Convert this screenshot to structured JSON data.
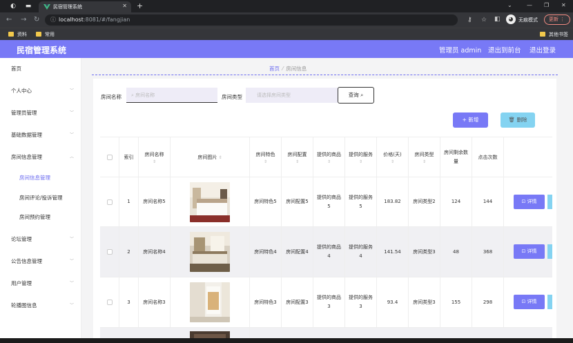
{
  "browser": {
    "tab_title": "民宿管理系统",
    "url_host": "localhost",
    "url_path": ":8081/#/fangjian",
    "incognito_label": "无痕模式",
    "update_label": "更新",
    "bookmarks": [
      "资料",
      "常用"
    ],
    "other_bookmarks": "其他书签"
  },
  "header": {
    "title": "民宿管理系统",
    "admin": "管理员 admin",
    "back_to_front": "退出到前台",
    "logout": "退出登录"
  },
  "sidebar": {
    "items": [
      {
        "label": "首页"
      },
      {
        "label": "个人中心"
      },
      {
        "label": "管理员管理"
      },
      {
        "label": "基础数据管理"
      },
      {
        "label": "房间信息管理"
      }
    ],
    "sub_items": [
      {
        "label": "房间信息管理"
      },
      {
        "label": "房间评论/投诉管理"
      },
      {
        "label": "房间预约管理"
      }
    ],
    "items_after": [
      {
        "label": "论坛管理"
      },
      {
        "label": "公告信息管理"
      },
      {
        "label": "用户管理"
      },
      {
        "label": "轮播图信息"
      }
    ]
  },
  "breadcrumb": {
    "home": "首页",
    "current": "房间信息"
  },
  "filters": {
    "name_label": "房间名称",
    "name_placeholder": "房间名称",
    "type_label": "房间类型",
    "type_placeholder": "请选择房间类型",
    "query_button": "查询"
  },
  "actions": {
    "add": "新增",
    "delete": "删除"
  },
  "table": {
    "headers": {
      "index": "索引",
      "name": "房间名称",
      "image": "房间图片",
      "feature": "房间特色",
      "config": "房间配置",
      "goods": "提供的商品",
      "service": "提供的服务",
      "price": "价格(天)",
      "type": "房间类型",
      "remaining": "房间剩余数量",
      "clicks": "点击次数"
    },
    "detail_label": "详情",
    "rows": [
      {
        "index": "1",
        "name": "房间名称5",
        "feature": "房间特色5",
        "config": "房间配置5",
        "goods": "提供的商品5",
        "service": "提供的服务5",
        "price": "183.82",
        "type": "房间类型2",
        "remaining": "124",
        "clicks": "144"
      },
      {
        "index": "2",
        "name": "房间名称4",
        "feature": "房间特色4",
        "config": "房间配置4",
        "goods": "提供的商品4",
        "service": "提供的服务4",
        "price": "141.54",
        "type": "房间类型3",
        "remaining": "48",
        "clicks": "368"
      },
      {
        "index": "3",
        "name": "房间名称3",
        "feature": "房间特色3",
        "config": "房间配置3",
        "goods": "提供的商品3",
        "service": "提供的服务3",
        "price": "93.4",
        "type": "房间类型3",
        "remaining": "155",
        "clicks": "298"
      }
    ]
  }
}
